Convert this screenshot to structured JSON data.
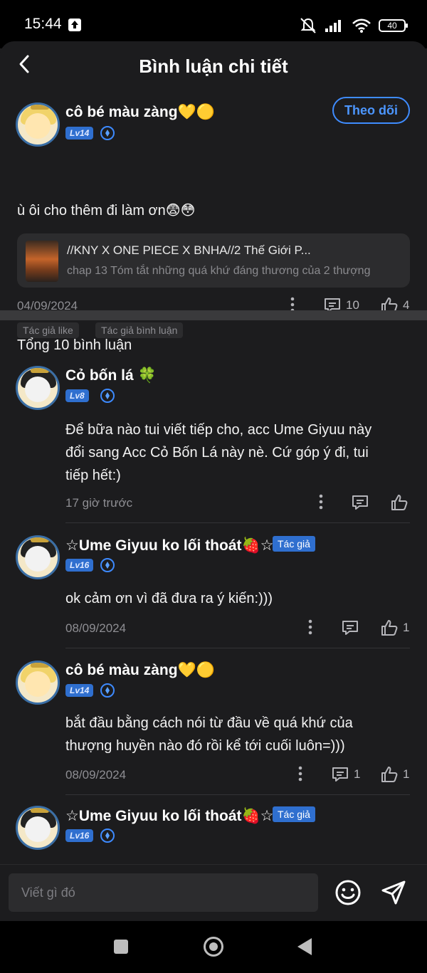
{
  "status": {
    "time": "15:44",
    "battery": "40"
  },
  "header": {
    "title": "Bình luận chi tiết"
  },
  "main_comment": {
    "username": "cô bé màu zàng💛🟡",
    "level": "Lv14",
    "follow_label": "Theo dõi",
    "text": "ù ôi cho thêm đi làm ơn😨😳",
    "story": {
      "title": "//KNY X ONE PIECE X BNHA//2 Thế Giới P...",
      "chapter": "chap 13 Tóm tắt những quá khứ đáng thương của 2 thượng"
    },
    "date": "04/09/2024",
    "reply_count": "10",
    "like_count": "4",
    "tags": [
      "Tác giả like",
      "Tác giả bình luận"
    ]
  },
  "total_label": "Tổng 10 bình luận",
  "replies": [
    {
      "username": "Cỏ bốn lá 🍀",
      "level": "Lv8",
      "author_tag": "",
      "text_lines": [
        "Để bữa nào tui viết tiếp cho, acc Ume Giyuu này",
        "đổi sang Acc Cỏ Bốn Lá này nè. Cứ góp ý đi, tui",
        "tiếp hết:)"
      ],
      "date": "17 giờ trước",
      "reply_count": "",
      "like_count": ""
    },
    {
      "username": "☆Ume Giyuu ko lối thoát🍓☆",
      "level": "Lv16",
      "author_tag": "Tác giả",
      "text_lines": [
        "ok cảm ơn vì đã đưa ra ý kiến:)))"
      ],
      "date": "08/09/2024",
      "reply_count": "",
      "like_count": "1"
    },
    {
      "username": "cô bé màu zàng💛🟡",
      "level": "Lv14",
      "author_tag": "",
      "text_lines": [
        "bắt đầu bằng cách nói từ đầu về quá khứ của",
        "thượng huyền nào đó rồi kể tới cuối luôn=)))"
      ],
      "date": "08/09/2024",
      "reply_count": "1",
      "like_count": "1"
    },
    {
      "username": "☆Ume Giyuu ko lối thoát🍓☆",
      "level": "Lv16",
      "author_tag": "Tác giả",
      "text_lines": [],
      "date": "",
      "reply_count": "",
      "like_count": ""
    }
  ],
  "composer": {
    "placeholder": "Viết gì đó"
  },
  "colors": {
    "background": "#1c1c1e",
    "accent": "#3f8cff",
    "badge": "#2f6fcf"
  },
  "icons": [
    "back-arrow-icon",
    "more-vertical-icon",
    "comment-icon",
    "thumbs-up-icon",
    "emoji-icon",
    "send-icon"
  ]
}
